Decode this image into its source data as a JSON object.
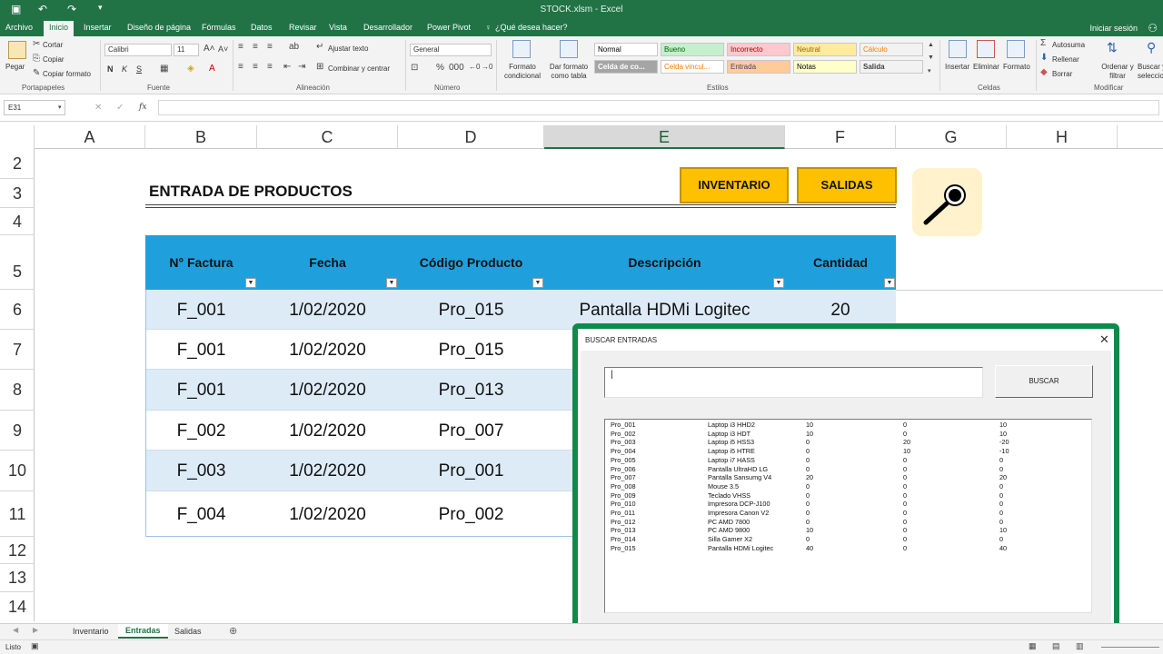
{
  "window": {
    "title": "STOCK.xlsm - Excel"
  },
  "ribbon_tabs": [
    "Archivo",
    "Inicio",
    "Insertar",
    "Diseño de página",
    "Fórmulas",
    "Datos",
    "Revisar",
    "Vista",
    "Desarrollador",
    "Power Pivot"
  ],
  "tell_me": "¿Qué desea hacer?",
  "login": "Iniciar sesión",
  "clipboard": {
    "paste": "Pegar",
    "cut": "Cortar",
    "copy": "Copiar",
    "format_painter": "Copiar formato",
    "group": "Portapapeles"
  },
  "font": {
    "name": "Calibri",
    "size": "11",
    "group": "Fuente",
    "bold": "N",
    "italic": "K",
    "underline": "S"
  },
  "alignment": {
    "wrap": "Ajustar texto",
    "merge": "Combinar y centrar",
    "group": "Alineación"
  },
  "number": {
    "format": "General",
    "group": "Número"
  },
  "styles_group": {
    "conditional": "Formato condicional",
    "as_table": "Dar formato como tabla",
    "group": "Estilos",
    "cells": [
      {
        "label": "Normal",
        "bg": "#ffffff",
        "fg": "#000000"
      },
      {
        "label": "Bueno",
        "bg": "#c6efce",
        "fg": "#006100"
      },
      {
        "label": "Incorrecto",
        "bg": "#ffc7ce",
        "fg": "#9c0006"
      },
      {
        "label": "Neutral",
        "bg": "#ffeb9c",
        "fg": "#9c6500"
      },
      {
        "label": "Cálculo",
        "bg": "#f2f2f2",
        "fg": "#fa7d00"
      },
      {
        "label": "Celda de co...",
        "bg": "#a5a5a5",
        "fg": "#ffffff"
      },
      {
        "label": "Celda vincul...",
        "bg": "#ffffff",
        "fg": "#fa7d00"
      },
      {
        "label": "Entrada",
        "bg": "#ffcc99",
        "fg": "#3f3f76"
      },
      {
        "label": "Notas",
        "bg": "#ffffcc",
        "fg": "#000000"
      },
      {
        "label": "Salida",
        "bg": "#f2f2f2",
        "fg": "#3f3f3f"
      }
    ]
  },
  "cells_group": {
    "insert": "Insertar",
    "delete": "Eliminar",
    "format": "Formato",
    "group": "Celdas"
  },
  "editing": {
    "autosum": "Autosuma",
    "fill": "Rellenar",
    "clear": "Borrar",
    "sort": "Ordenar y filtrar",
    "find": "Buscar y seleccionar",
    "group": "Modificar"
  },
  "name_box": "E31",
  "fx": "fx",
  "columns": [
    "A",
    "B",
    "C",
    "D",
    "E",
    "F",
    "G",
    "H"
  ],
  "rows": [
    "2",
    "3",
    "4",
    "5",
    "6",
    "7",
    "8",
    "9",
    "10",
    "11",
    "12",
    "13",
    "14"
  ],
  "sheet": {
    "title": "ENTRADA DE PRODUCTOS",
    "btn_inventario": "INVENTARIO",
    "btn_salidas": "SALIDAS"
  },
  "table": {
    "headers": [
      "N° Factura",
      "Fecha",
      "Código Producto",
      "Descripción",
      "Cantidad"
    ],
    "filter_glyph": "▼",
    "rows": [
      [
        "F_001",
        "1/02/2020",
        "Pro_015",
        "Pantalla HDMi Logitec",
        "20"
      ],
      [
        "F_001",
        "1/02/2020",
        "Pro_015",
        "",
        ""
      ],
      [
        "F_001",
        "1/02/2020",
        "Pro_013",
        "",
        ""
      ],
      [
        "F_002",
        "1/02/2020",
        "Pro_007",
        "",
        ""
      ],
      [
        "F_003",
        "1/02/2020",
        "Pro_001",
        "",
        ""
      ],
      [
        "F_004",
        "1/02/2020",
        "Pro_002",
        "",
        ""
      ]
    ]
  },
  "dialog": {
    "title": "BUSCAR ENTRADAS",
    "close": "✕",
    "search_value": "|",
    "button": "BUSCAR",
    "list": [
      [
        "Pro_001",
        "Laptop i3 HHD2",
        "10",
        "0",
        "10"
      ],
      [
        "Pro_002",
        "Laptop i3 HDT",
        "10",
        "0",
        "10"
      ],
      [
        "Pro_003",
        "Laptop i5 HSS3",
        "0",
        "20",
        "-20"
      ],
      [
        "Pro_004",
        "Laptop i5 HTRE",
        "0",
        "10",
        "-10"
      ],
      [
        "Pro_005",
        "Laptop i7 HASS",
        "0",
        "0",
        "0"
      ],
      [
        "Pro_006",
        "Pantalla UltraHD LG",
        "0",
        "0",
        "0"
      ],
      [
        "Pro_007",
        "Pantalla Sansumg V4",
        "20",
        "0",
        "20"
      ],
      [
        "Pro_008",
        "Mouse 3.5",
        "0",
        "0",
        "0"
      ],
      [
        "Pro_009",
        "Teclado VHSS",
        "0",
        "0",
        "0"
      ],
      [
        "Pro_010",
        "Impresora DCP-J100",
        "0",
        "0",
        "0"
      ],
      [
        "Pro_011",
        "Impresora Canon V2",
        "0",
        "0",
        "0"
      ],
      [
        "Pro_012",
        "PC AMD 7800",
        "0",
        "0",
        "0"
      ],
      [
        "Pro_013",
        "PC AMD 9800",
        "10",
        "0",
        "10"
      ],
      [
        "Pro_014",
        "Silla Gamer X2",
        "0",
        "0",
        "0"
      ],
      [
        "Pro_015",
        "Pantalla HDMi Logitec",
        "40",
        "0",
        "40"
      ]
    ]
  },
  "sheet_tabs": [
    "Inventario",
    "Entradas",
    "Salidas"
  ],
  "status": "Listo",
  "colors": {
    "excel_green": "#217346",
    "table_header": "#1fa0dc",
    "band": "#ddebf7",
    "button_yellow": "#ffc000",
    "dialog_border": "#0f8a4a"
  }
}
